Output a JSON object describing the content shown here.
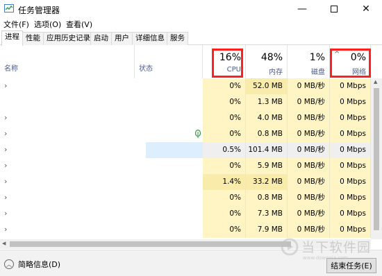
{
  "window": {
    "title": "任务管理器"
  },
  "menu": [
    "文件(F)",
    "选项(O)",
    "查看(V)"
  ],
  "tabs": [
    {
      "label": "进程",
      "active": true
    },
    {
      "label": "性能"
    },
    {
      "label": "应用历史记录"
    },
    {
      "label": "启动"
    },
    {
      "label": "用户"
    },
    {
      "label": "详细信息"
    },
    {
      "label": "服务"
    }
  ],
  "columns": {
    "name": "名称",
    "status": "状态",
    "cpu": {
      "pct": "16%",
      "label": "CPU"
    },
    "memory": {
      "pct": "48%",
      "label": "内存"
    },
    "disk": {
      "pct": "1%",
      "label": "磁盘"
    },
    "network": {
      "pct": "0%",
      "label": "网络",
      "sort_arrow": "^"
    }
  },
  "rows": [
    {
      "cpu": "0%",
      "memory": "52.0 MB",
      "disk": "0 MB/秒",
      "network": "0 Mbps",
      "expandable": true
    },
    {
      "cpu": "0%",
      "memory": "1.3 MB",
      "disk": "0 MB/秒",
      "network": "0 Mbps",
      "expandable": false
    },
    {
      "cpu": "0%",
      "memory": "4.0 MB",
      "disk": "0 MB/秒",
      "network": "0 Mbps",
      "expandable": true
    },
    {
      "cpu": "0%",
      "memory": "0.8 MB",
      "disk": "0 MB/秒",
      "network": "0 Mbps",
      "expandable": true,
      "leaf_icon": true
    },
    {
      "cpu": "0.5%",
      "memory": "101.4 MB",
      "disk": "0 MB/秒",
      "network": "0 Mbps",
      "expandable": true,
      "selected": true
    },
    {
      "cpu": "0%",
      "memory": "5.9 MB",
      "disk": "0 MB/秒",
      "network": "0 Mbps",
      "expandable": true
    },
    {
      "cpu": "1.4%",
      "memory": "33.2 MB",
      "disk": "0 MB/秒",
      "network": "0 Mbps",
      "expandable": true
    },
    {
      "cpu": "0%",
      "memory": "0.8 MB",
      "disk": "0 MB/秒",
      "network": "0 Mbps",
      "expandable": true
    },
    {
      "cpu": "0%",
      "memory": "7.3 MB",
      "disk": "0 MB/秒",
      "network": "0 Mbps",
      "expandable": true
    },
    {
      "cpu": "0%",
      "memory": "7.9 MB",
      "disk": "0 MB/秒",
      "network": "0 Mbps",
      "expandable": true
    }
  ],
  "footer": {
    "brief": "简略信息(D)",
    "end_task": "结束任务(E)"
  },
  "watermark": {
    "text": "当下软件园",
    "sub": "www.downxia.com"
  },
  "colors": {
    "highlight": "#ff1f1f",
    "heat_light": "#fff4c4",
    "heat_mid": "#f9ecaa",
    "selected": "#ddeeff"
  }
}
